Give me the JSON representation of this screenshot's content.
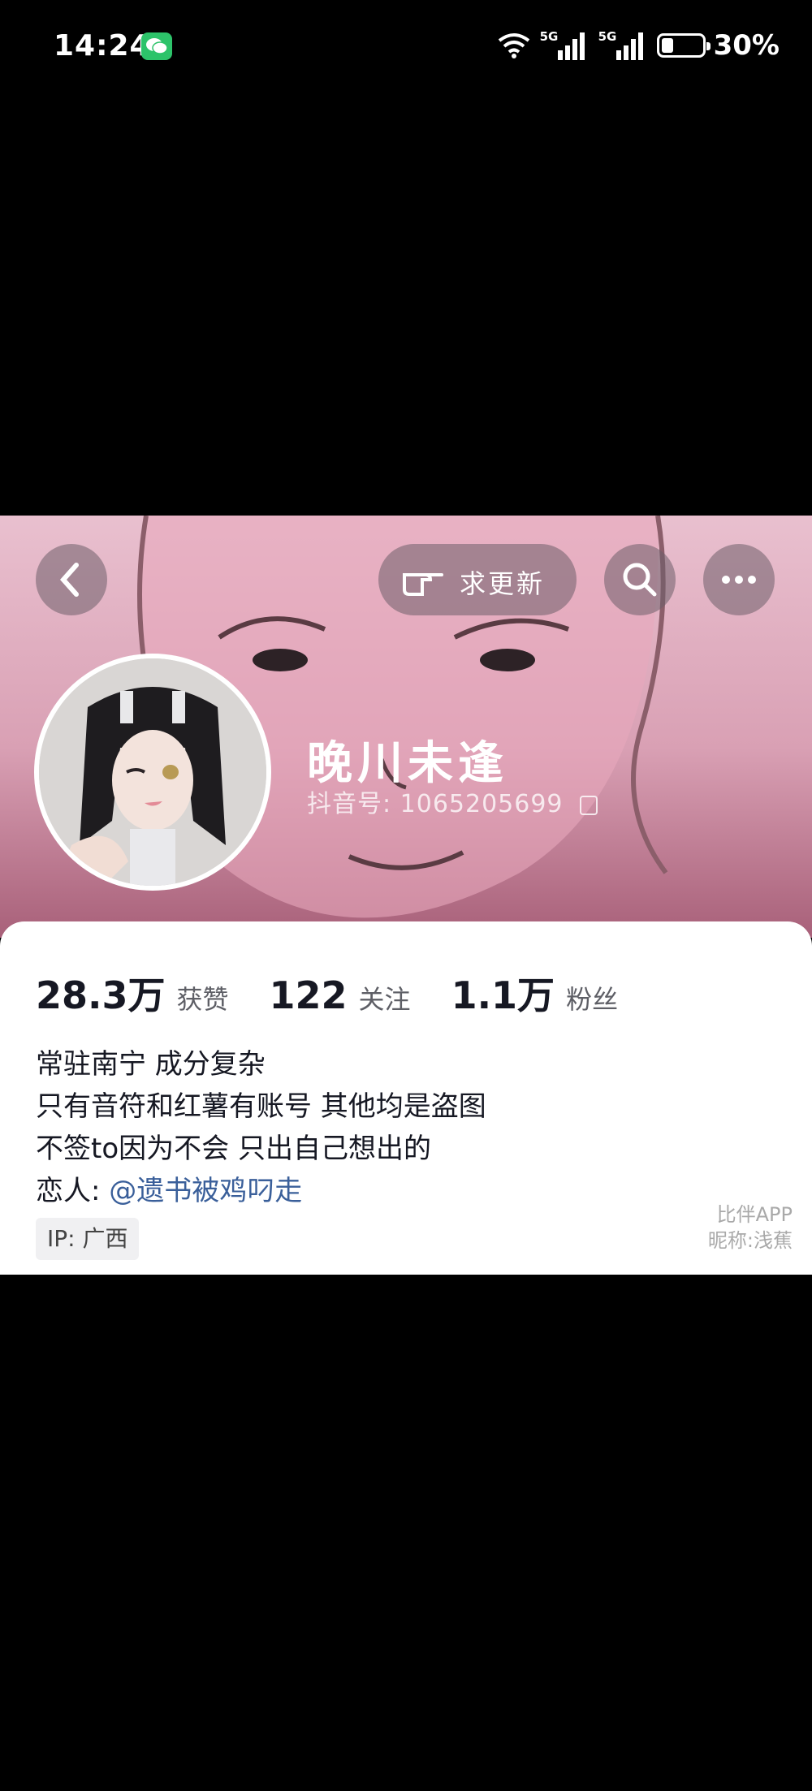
{
  "status_bar": {
    "time": "14:24",
    "network_labels": [
      "5G",
      "5G"
    ],
    "battery_percent": "30%",
    "battery_level": 0.3
  },
  "profile": {
    "update_button_label": "求更新",
    "username": "晚川未逢",
    "douyin_id": "抖音号: 1065205699",
    "stats": [
      {
        "value": "28.3万",
        "label": "获赞"
      },
      {
        "value": "122",
        "label": "关注"
      },
      {
        "value": "1.1万",
        "label": "粉丝"
      }
    ],
    "bio": [
      "常驻南宁 成分复杂",
      "只有音符和红薯有账号 其他均是盗图",
      "不签to因为不会 只出自己想出的"
    ],
    "lover_prefix": "恋人: ",
    "lover_link": "@遗书被鸡叼走",
    "ip": "IP: 广西"
  },
  "watermark": {
    "line1": "比伴APP",
    "line2": "昵称:浅蕉"
  },
  "colors": {
    "accent_link": "#3a5f9a",
    "wechat_green": "#2dc36a",
    "banner_pink": "#d9a0b4"
  }
}
